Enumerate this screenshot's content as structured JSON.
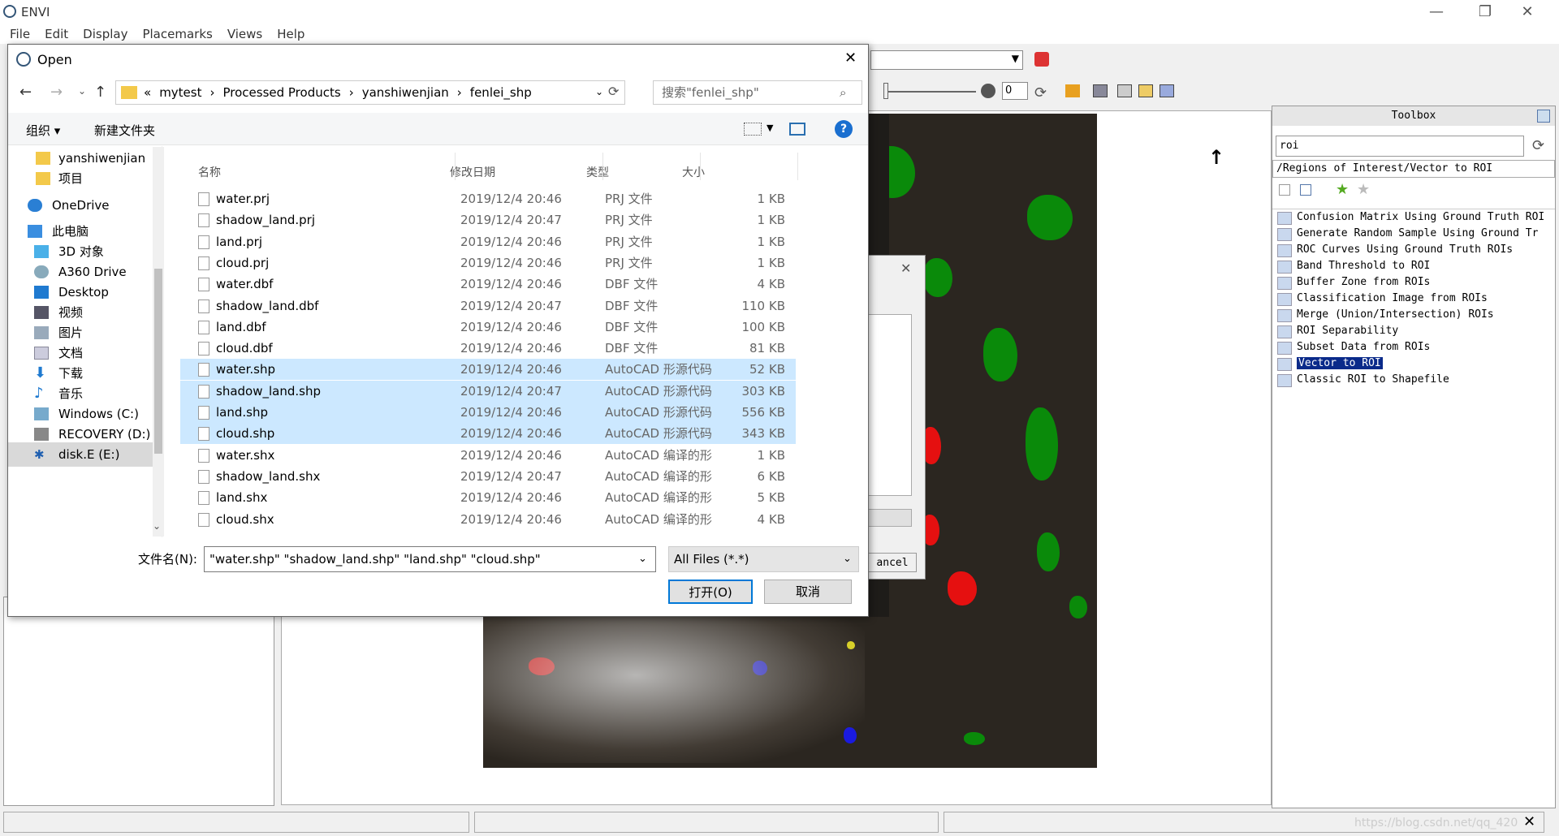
{
  "app": {
    "title": "ENVI",
    "menu": [
      "File",
      "Edit",
      "Display",
      "Placemarks",
      "Views",
      "Help"
    ],
    "window_controls": {
      "minimize": "—",
      "restore": "❐",
      "close": "✕"
    }
  },
  "toolbar": {
    "zoom_value": "0"
  },
  "toolbox": {
    "title": "Toolbox",
    "search_value": "roi",
    "path": "/Regions of Interest/Vector to ROI",
    "items": [
      "Confusion Matrix Using Ground Truth ROI",
      "Generate Random Sample Using Ground Tr",
      "ROC Curves Using Ground Truth ROIs",
      "Band Threshold to ROI",
      "Buffer Zone from ROIs",
      "Classification Image from ROIs",
      "Merge (Union/Intersection) ROIs",
      "ROI Separability",
      "Subset Data from ROIs",
      "Vector to ROI",
      "Classic ROI to Shapefile"
    ],
    "selected_index": 9
  },
  "back_dialog": {
    "cancel_label": "ancel"
  },
  "statusbar": {
    "watermark": "https://blog.csdn.net/qq_420"
  },
  "dialog": {
    "title": "Open",
    "breadcrumb": [
      "«",
      "mytest",
      "›",
      "Processed Products",
      "›",
      "yanshiwenjian",
      "›",
      "fenlei_shp"
    ],
    "search_placeholder": "搜索\"fenlei_shp\"",
    "organize_label": "组织 ▾",
    "new_folder_label": "新建文件夹",
    "nav_items": [
      "yanshiwenjian",
      "项目",
      "OneDrive",
      "此电脑",
      "3D 对象",
      "A360 Drive",
      "Desktop",
      "视频",
      "图片",
      "文档",
      "下载",
      "音乐",
      "Windows (C:)",
      "RECOVERY (D:)",
      "disk.E (E:)"
    ],
    "columns": {
      "name": "名称",
      "date": "修改日期",
      "type": "类型",
      "size": "大小"
    },
    "files": [
      {
        "name": "water.prj",
        "date": "2019/12/4 20:46",
        "type": "PRJ 文件",
        "size": "1 KB"
      },
      {
        "name": "shadow_land.prj",
        "date": "2019/12/4 20:47",
        "type": "PRJ 文件",
        "size": "1 KB"
      },
      {
        "name": "land.prj",
        "date": "2019/12/4 20:46",
        "type": "PRJ 文件",
        "size": "1 KB"
      },
      {
        "name": "cloud.prj",
        "date": "2019/12/4 20:46",
        "type": "PRJ 文件",
        "size": "1 KB"
      },
      {
        "name": "water.dbf",
        "date": "2019/12/4 20:46",
        "type": "DBF 文件",
        "size": "4 KB"
      },
      {
        "name": "shadow_land.dbf",
        "date": "2019/12/4 20:47",
        "type": "DBF 文件",
        "size": "110 KB"
      },
      {
        "name": "land.dbf",
        "date": "2019/12/4 20:46",
        "type": "DBF 文件",
        "size": "100 KB"
      },
      {
        "name": "cloud.dbf",
        "date": "2019/12/4 20:46",
        "type": "DBF 文件",
        "size": "81 KB"
      },
      {
        "name": "water.shp",
        "date": "2019/12/4 20:46",
        "type": "AutoCAD 形源代码",
        "size": "52 KB",
        "selected": true
      },
      {
        "name": "shadow_land.shp",
        "date": "2019/12/4 20:47",
        "type": "AutoCAD 形源代码",
        "size": "303 KB",
        "selected": true
      },
      {
        "name": "land.shp",
        "date": "2019/12/4 20:46",
        "type": "AutoCAD 形源代码",
        "size": "556 KB",
        "selected": true
      },
      {
        "name": "cloud.shp",
        "date": "2019/12/4 20:46",
        "type": "AutoCAD 形源代码",
        "size": "343 KB",
        "selected": true
      },
      {
        "name": "water.shx",
        "date": "2019/12/4 20:46",
        "type": "AutoCAD 编译的形",
        "size": "1 KB"
      },
      {
        "name": "shadow_land.shx",
        "date": "2019/12/4 20:47",
        "type": "AutoCAD 编译的形",
        "size": "6 KB"
      },
      {
        "name": "land.shx",
        "date": "2019/12/4 20:46",
        "type": "AutoCAD 编译的形",
        "size": "5 KB"
      },
      {
        "name": "cloud.shx",
        "date": "2019/12/4 20:46",
        "type": "AutoCAD 编译的形",
        "size": "4 KB"
      }
    ],
    "filename_label": "文件名(N):",
    "filename_value": "\"water.shp\" \"shadow_land.shp\" \"land.shp\" \"cloud.shp\"",
    "filetype_value": "All Files (*.*)",
    "open_label": "打开(O)",
    "cancel_label": "取消"
  }
}
